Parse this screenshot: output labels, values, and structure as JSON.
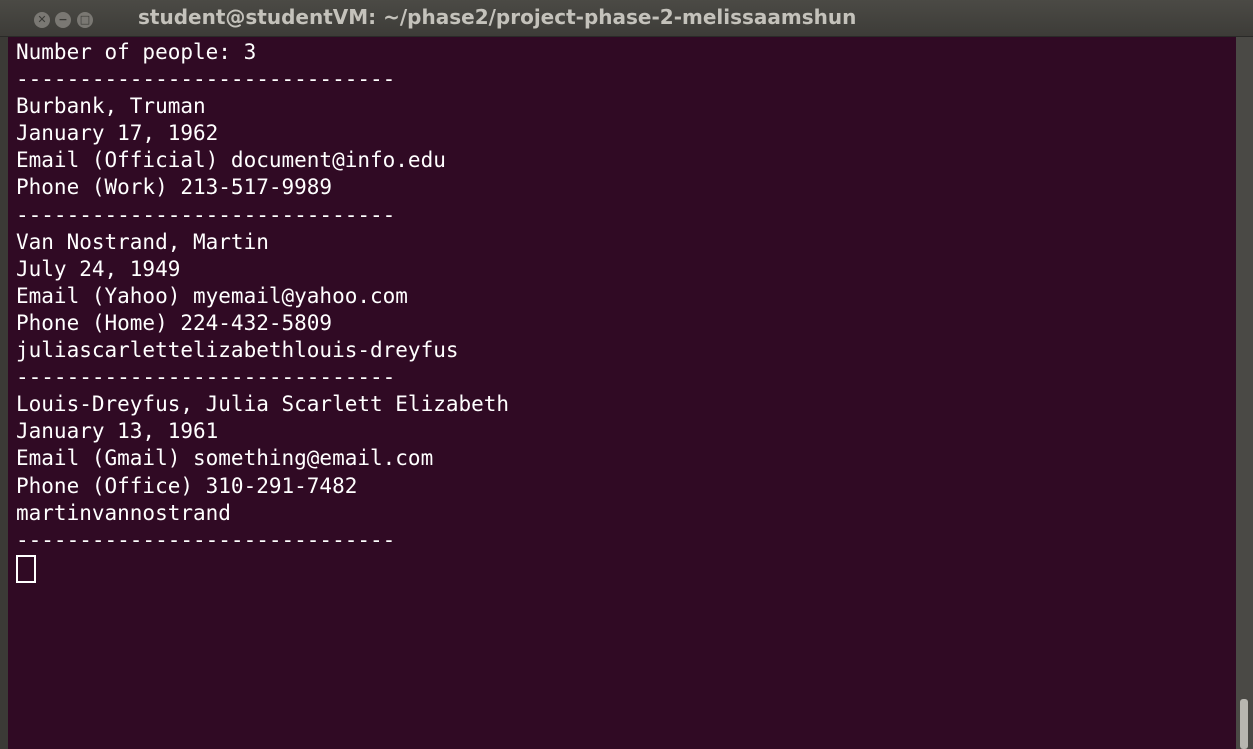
{
  "window": {
    "title": "student@studentVM: ~/phase2/project-phase-2-melissaamshun",
    "buttons": {
      "close_glyph": "✕",
      "minimize_glyph": "−",
      "maximize_glyph": "□"
    }
  },
  "terminal": {
    "colors": {
      "background": "#300a24",
      "foreground": "#ffffff"
    },
    "lines": [
      "Number of people: 3",
      "------------------------------",
      "Burbank, Truman",
      "January 17, 1962",
      "Email (Official) document@info.edu",
      "Phone (Work) 213-517-9989",
      "------------------------------",
      "Van Nostrand, Martin",
      "July 24, 1949",
      "Email (Yahoo) myemail@yahoo.com",
      "Phone (Home) 224-432-5809",
      "juliascarlettelizabethlouis-dreyfus",
      "------------------------------",
      "Louis-Dreyfus, Julia Scarlett Elizabeth",
      "January 13, 1961",
      "Email (Gmail) something@email.com",
      "Phone (Office) 310-291-7482",
      "martinvannostrand",
      "------------------------------"
    ]
  }
}
